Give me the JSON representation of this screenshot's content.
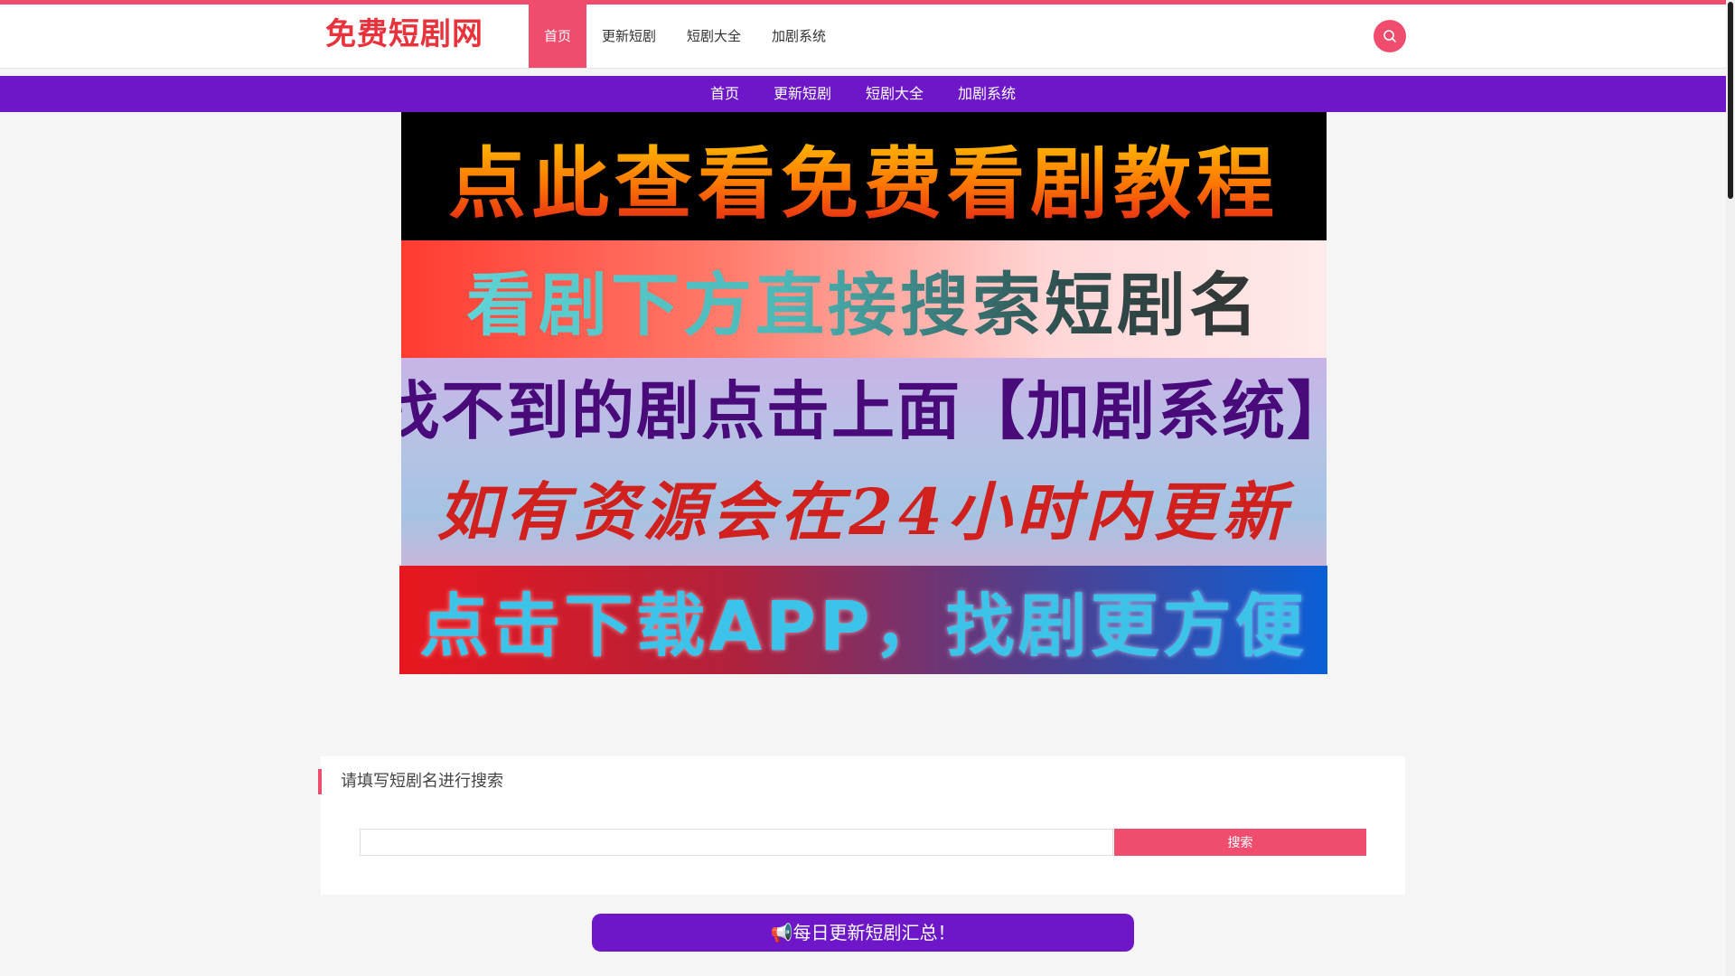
{
  "site": {
    "logo_text": "免费短剧网"
  },
  "nav": {
    "main": [
      {
        "label": "首页",
        "active": true
      },
      {
        "label": "更新短剧",
        "active": false
      },
      {
        "label": "短剧大全",
        "active": false
      },
      {
        "label": "加剧系统",
        "active": false
      }
    ],
    "sub": [
      {
        "label": "首页"
      },
      {
        "label": "更新短剧"
      },
      {
        "label": "短剧大全"
      },
      {
        "label": "加剧系统"
      }
    ]
  },
  "banners": {
    "b1": "点此查看免费看剧教程",
    "b2": "看剧下方直接搜索短剧名",
    "b3_line1": "找不到的剧点击上面【加剧系统】",
    "b3_line2": "如有资源会在24小时内更新",
    "b4": "点击下载APP，找剧更方便"
  },
  "search": {
    "title": "请填写短剧名进行搜索",
    "input_value": "",
    "button_label": "搜索"
  },
  "notice": {
    "label": "📢每日更新短剧汇总！"
  },
  "colors": {
    "accent": "#ef4c6e",
    "purple": "#6d17c9",
    "logo": "#e8333c"
  },
  "icons": {
    "search": "search-icon"
  }
}
